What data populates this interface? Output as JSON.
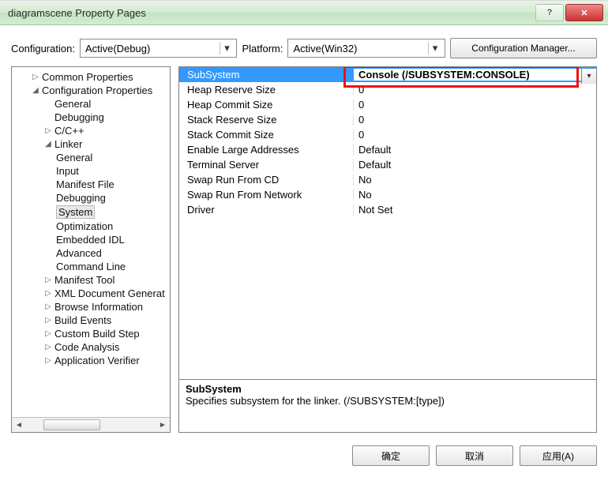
{
  "window": {
    "title": "diagramscene Property Pages"
  },
  "toolbar": {
    "configuration_label": "Configuration:",
    "configuration_value": "Active(Debug)",
    "platform_label": "Platform:",
    "platform_value": "Active(Win32)",
    "config_manager_label": "Configuration Manager..."
  },
  "tree": {
    "common_properties": "Common Properties",
    "config_properties": "Configuration Properties",
    "items": {
      "general": "General",
      "debugging": "Debugging",
      "ccpp": "C/C++",
      "linker": "Linker",
      "linker_general": "General",
      "linker_input": "Input",
      "linker_manifest": "Manifest File",
      "linker_debugging": "Debugging",
      "linker_system": "System",
      "linker_optimization": "Optimization",
      "linker_embedded_idl": "Embedded IDL",
      "linker_advanced": "Advanced",
      "linker_cmdline": "Command Line",
      "manifest_tool": "Manifest Tool",
      "xml_doc_gen": "XML Document Generat",
      "browse_info": "Browse Information",
      "build_events": "Build Events",
      "custom_build": "Custom Build Step",
      "code_analysis": "Code Analysis",
      "app_verifier": "Application Verifier"
    }
  },
  "grid": {
    "rows": [
      {
        "name": "SubSystem",
        "value": "Console (/SUBSYSTEM:CONSOLE)",
        "selected": true
      },
      {
        "name": "Heap Reserve Size",
        "value": "0"
      },
      {
        "name": "Heap Commit Size",
        "value": "0"
      },
      {
        "name": "Stack Reserve Size",
        "value": "0"
      },
      {
        "name": "Stack Commit Size",
        "value": "0"
      },
      {
        "name": "Enable Large Addresses",
        "value": "Default"
      },
      {
        "name": "Terminal Server",
        "value": "Default"
      },
      {
        "name": "Swap Run From CD",
        "value": "No"
      },
      {
        "name": "Swap Run From Network",
        "value": "No"
      },
      {
        "name": "Driver",
        "value": "Not Set"
      }
    ]
  },
  "description": {
    "title": "SubSystem",
    "text": "Specifies subsystem for the linker.     (/SUBSYSTEM:[type])"
  },
  "buttons": {
    "ok": "确定",
    "cancel": "取消",
    "apply": "应用(A)"
  }
}
